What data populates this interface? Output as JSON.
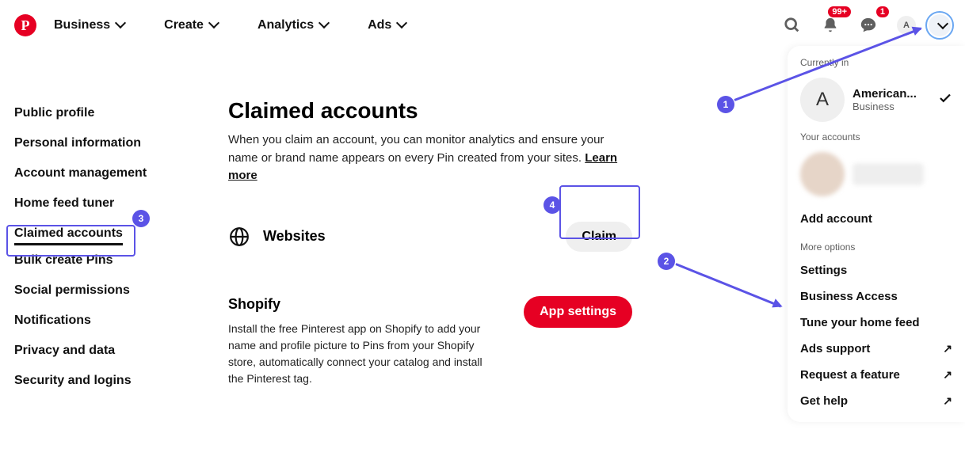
{
  "nav": {
    "business": "Business",
    "create": "Create",
    "analytics": "Analytics",
    "ads": "Ads"
  },
  "topbar": {
    "notif_badge": "99+",
    "msg_badge": "1",
    "avatar_letter": "A"
  },
  "sidebar": {
    "items": [
      "Public profile",
      "Personal information",
      "Account management",
      "Home feed tuner",
      "Claimed accounts",
      "Bulk create Pins",
      "Social permissions",
      "Notifications",
      "Privacy and data",
      "Security and logins"
    ]
  },
  "main": {
    "title": "Claimed accounts",
    "desc": "When you claim an account, you can monitor analytics and ensure your name or brand name appears on every Pin created from your sites. ",
    "learn": "Learn more",
    "websites_label": "Websites",
    "claim_label": "Claim",
    "shopify_title": "Shopify",
    "shopify_desc": "Install the free Pinterest app on Shopify to add your name and profile picture to Pins from your Shopify store, automatically connect your catalog and install the Pinterest tag.",
    "app_settings": "App settings"
  },
  "dropdown": {
    "currently_in": "Currently in",
    "account_name": "American...",
    "account_type": "Business",
    "current_letter": "A",
    "your_accounts": "Your accounts",
    "add_account": "Add account",
    "more_options": "More options",
    "items": [
      "Settings",
      "Business Access",
      "Tune your home feed",
      "Ads support",
      "Request a feature",
      "Get help"
    ]
  },
  "markers": {
    "m1": "1",
    "m2": "2",
    "m3": "3",
    "m4": "4"
  }
}
